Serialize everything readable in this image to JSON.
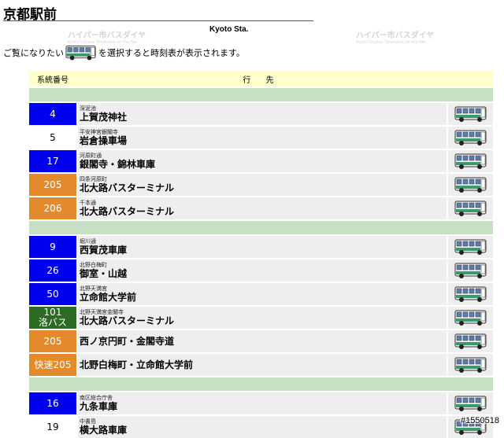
{
  "page": {
    "title": "京都駅前",
    "station_en": "Kyoto Sta.",
    "watermark": "ハイパー市バスダイヤ",
    "watermark_sub": "Kyoto Citybus Timetable on the Net",
    "instruction_before": "ご覧になりたい",
    "instruction_after": "を選択すると時刻表が表示されます。",
    "copyright": "#1550518"
  },
  "table": {
    "header_number": "系統番号",
    "header_destination": "行 先"
  },
  "groups": [
    {
      "rows": [
        {
          "number": "4",
          "number2": "",
          "color": "blue",
          "via": "深泥池",
          "destination": "上賀茂神社"
        },
        {
          "number": "5",
          "number2": "",
          "color": "white",
          "via": "平安神宮銀閣寺",
          "destination": "岩倉操車場"
        },
        {
          "number": "17",
          "number2": "",
          "color": "blue",
          "via": "河原町通",
          "destination": "銀閣寺・錦林車庫"
        },
        {
          "number": "205",
          "number2": "",
          "color": "orange",
          "via": "四条河原町",
          "destination": "北大路バスターミナル"
        },
        {
          "number": "206",
          "number2": "",
          "color": "orange",
          "via": "千本通",
          "destination": "北大路バスターミナル"
        }
      ]
    },
    {
      "rows": [
        {
          "number": "9",
          "number2": "",
          "color": "blue",
          "via": "堀川通",
          "destination": "西賀茂車庫"
        },
        {
          "number": "26",
          "number2": "",
          "color": "blue",
          "via": "北野白梅町",
          "destination": "御室・山越"
        },
        {
          "number": "50",
          "number2": "",
          "color": "blue",
          "via": "北野天満宮",
          "destination": "立命館大学前"
        },
        {
          "number": "101",
          "number2": "洛バス",
          "color": "green",
          "via": "北野天満宮金閣寺",
          "destination": "北大路バスターミナル"
        },
        {
          "number": "205",
          "number2": "",
          "color": "orange",
          "via": "",
          "destination": "西ノ京円町・金閣寺道"
        },
        {
          "number": "快速205",
          "number2": "",
          "color": "orange",
          "via": "",
          "destination": "北野白梅町・立命館大学前"
        }
      ]
    },
    {
      "rows": [
        {
          "number": "16",
          "number2": "",
          "color": "blue",
          "via": "南区総合庁舎",
          "destination": "九条車庫"
        },
        {
          "number": "19",
          "number2": "",
          "color": "white",
          "via": "中書島",
          "destination": "横大路車庫"
        }
      ]
    }
  ],
  "colors": {
    "blue": "#0000ee",
    "orange": "#e48a2c",
    "green": "#2d6a24",
    "header_bg": "#ffffcc",
    "separator": "#c7dfc3",
    "cell_bg": "#eeeeee"
  },
  "icons": {
    "timetable_button": "bus-icon"
  }
}
